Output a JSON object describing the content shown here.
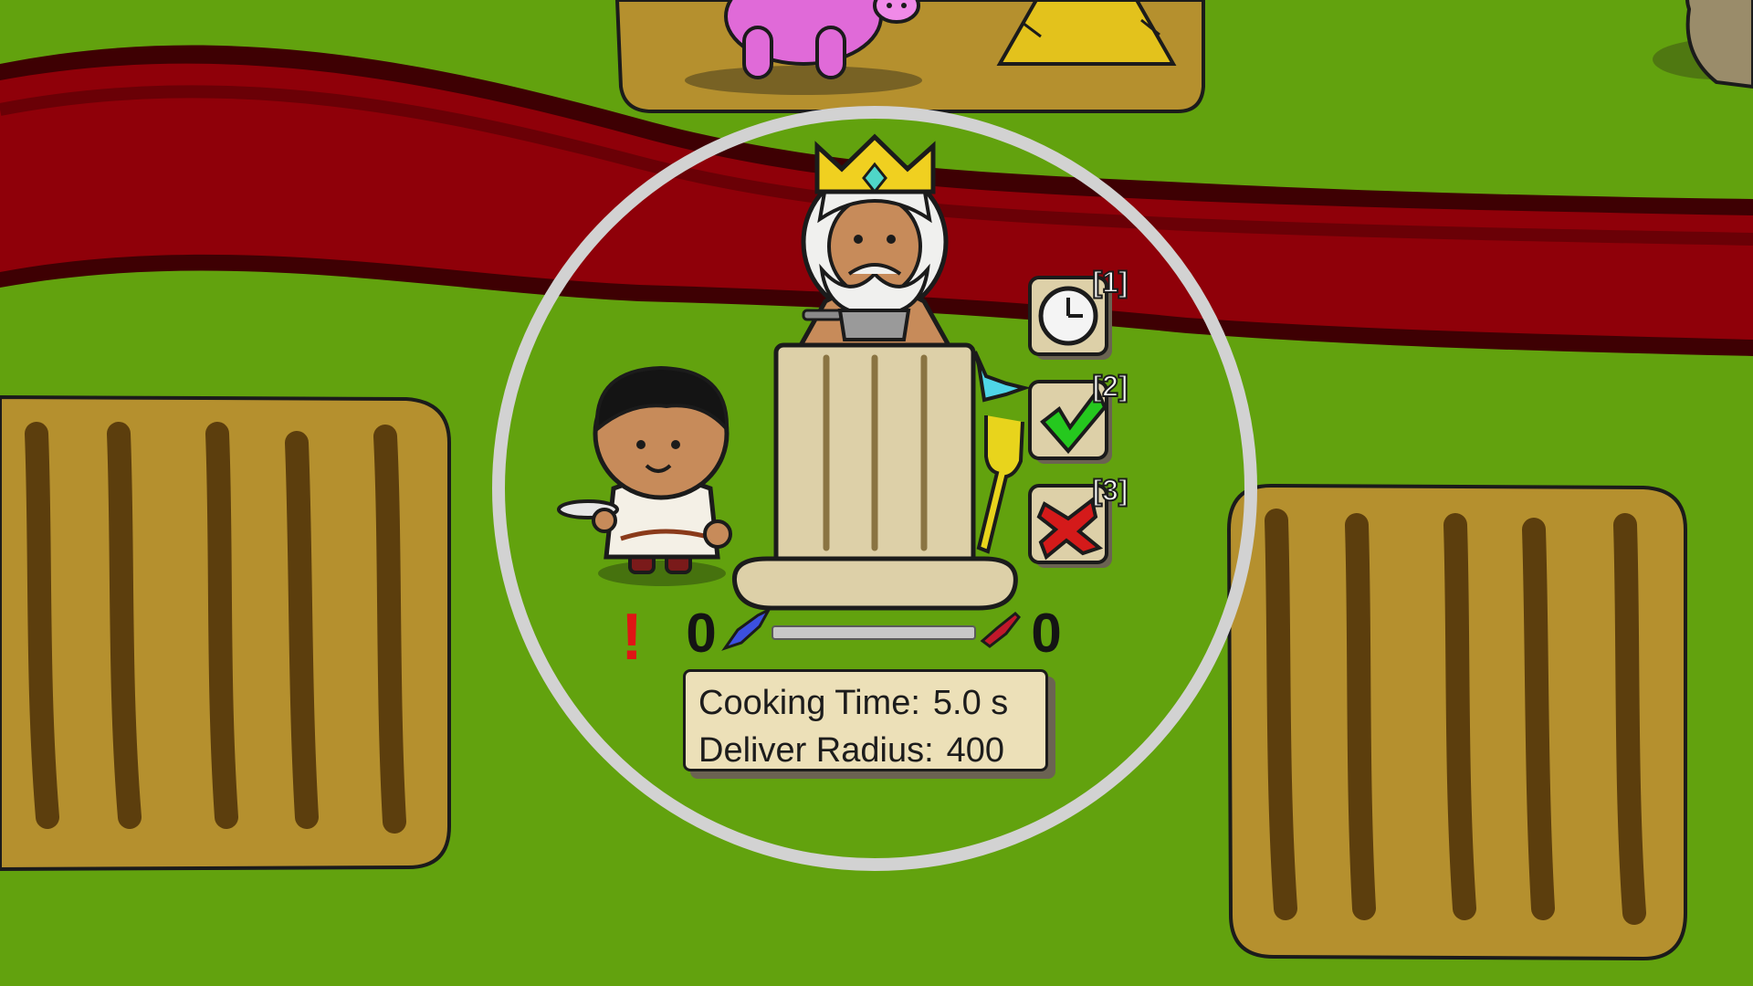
{
  "hud": {
    "score_left": "0",
    "score_right": "0",
    "progress": 0,
    "alert_symbol": "!"
  },
  "actions": [
    {
      "key": "[1]",
      "name": "wait",
      "icon": "clock-icon"
    },
    {
      "key": "[2]",
      "name": "accept",
      "icon": "checkmark-icon"
    },
    {
      "key": "[3]",
      "name": "reject",
      "icon": "cross-icon"
    }
  ],
  "info_panel": {
    "cooking_time_label": "Cooking Time:",
    "cooking_time_value": "5.0 s",
    "deliver_radius_label": "Deliver Radius:",
    "deliver_radius_value": "400"
  },
  "colors": {
    "grass": "#62a20e",
    "road": "#8f0009",
    "field": "#b5902e",
    "selection_ring": "#d2d2d2",
    "alert": "#e01515",
    "check": "#25c81e",
    "cross": "#d41a1a"
  }
}
